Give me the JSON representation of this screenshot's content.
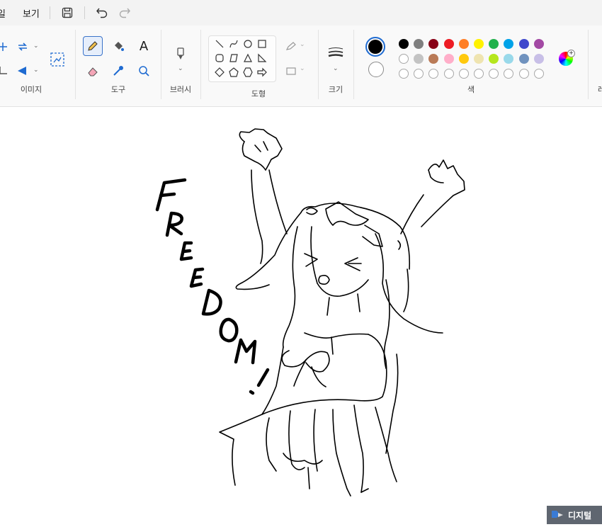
{
  "menubar": {
    "partial_item": "일",
    "view_label": "보기",
    "save_icon": "save-icon",
    "undo_icon": "undo-icon",
    "redo_icon": "redo-icon"
  },
  "ribbon": {
    "groups": {
      "image": "이미지",
      "tools": "도구",
      "brushes": "브러시",
      "shapes": "도형",
      "size": "크기",
      "colors": "색",
      "partial_right": "레"
    },
    "text_tool_glyph": "A"
  },
  "colors": {
    "primary": "#000000",
    "secondary": "#ffffff",
    "palette_row1": [
      "#000000",
      "#7f7f7f",
      "#880015",
      "#ed1c24",
      "#ff7f27",
      "#fff200",
      "#22b14c",
      "#00a2e8",
      "#3f48cc",
      "#a349a4"
    ],
    "palette_row2": [
      "#ffffff",
      "#c3c3c3",
      "#b97a57",
      "#ffaec9",
      "#ffc90e",
      "#efe4b0",
      "#b5e61d",
      "#99d9ea",
      "#7092be",
      "#c8bfe7"
    ],
    "palette_row3_count": 10
  },
  "canvas": {
    "drawing_text": "FREEDOM!",
    "description_icon": "drawing"
  },
  "watermark": {
    "text": "디지털"
  }
}
